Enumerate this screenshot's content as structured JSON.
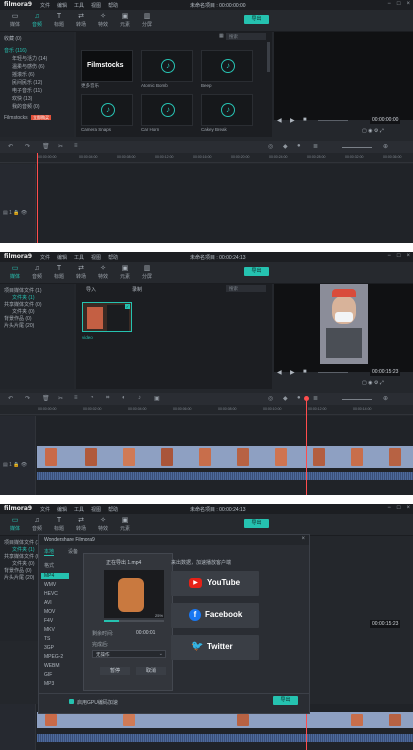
{
  "app": {
    "logo": "filmora9",
    "menu": [
      "文件",
      "编辑",
      "工具",
      "视图",
      "帮助"
    ],
    "title_1": "未命名项目 : 00:00:00:00",
    "title_2": "未命名项目 : 00:00:24:13",
    "title_3": "未命名项目 : 00:00:24:13",
    "window_controls": [
      "−",
      "□",
      "×"
    ],
    "export_label": "导出"
  },
  "toolbar": {
    "tabs": [
      {
        "label": "媒体",
        "icon": "folder-icon"
      },
      {
        "label": "音频",
        "icon": "music-icon"
      },
      {
        "label": "标题",
        "icon": "text-icon"
      },
      {
        "label": "转场",
        "icon": "transition-icon"
      },
      {
        "label": "特效",
        "icon": "effects-icon"
      },
      {
        "label": "元素",
        "icon": "elements-icon"
      },
      {
        "label": "分屏",
        "icon": "splitscreen-icon"
      }
    ],
    "tabs_short": [
      "媒体",
      "音频",
      "标题",
      "转场",
      "特效",
      "元素",
      "分屏"
    ]
  },
  "panel1": {
    "sidebar": {
      "favorites": "收藏 (0)",
      "music": "音乐 (116)",
      "items": [
        "年轻与活力 (14)",
        "温柔与感伤 (6)",
        "摇滚乐 (6)",
        "民间民乐 (12)",
        "电子音乐 (11)",
        "欢快 (13)",
        "我的音频 (0)"
      ],
      "filmstocks": "Filmstocks",
      "filmstocks_badge": "立即购买"
    },
    "search_placeholder": "搜索",
    "items": [
      {
        "label": "更多音乐",
        "kind": "filmstocks",
        "text": "Filmstocks"
      },
      {
        "label": "Atomic Bomb",
        "kind": "music"
      },
      {
        "label": "Beep",
        "kind": "music"
      },
      {
        "label": "Camera Snaps",
        "kind": "music"
      },
      {
        "label": "Car Horn",
        "kind": "music"
      },
      {
        "label": "Cakey Break",
        "kind": "music"
      }
    ],
    "timecode": "00:00:00:00",
    "ruler": [
      "00:00:00:00",
      "00:00:04:00",
      "00:00:08:00",
      "00:00:12:00",
      "00:00:16:00",
      "00:00:20:00",
      "00:00:24:00",
      "00:00:28:00",
      "00:00:32:00",
      "00:00:36:00",
      "00:00:40:00"
    ]
  },
  "panel2": {
    "sidebar": {
      "items": [
        "项目媒体文件 (1)",
        "文件夹 (1)",
        "共享媒体文件 (0)",
        "文件夹 (0)",
        "背景作品 (0)",
        "片头片尾 (20)"
      ]
    },
    "import_label": "导入",
    "record_label": "录制",
    "search_placeholder": "搜索",
    "clip_label": "video",
    "timecode": "00:00:15:23",
    "ruler": [
      "00:00:00:00",
      "00:00:02:00",
      "00:00:04:00",
      "00:00:06:00",
      "00:00:08:00",
      "00:00:10:00",
      "00:00:12:00",
      "00:00:14:00"
    ]
  },
  "panel3": {
    "dialog": {
      "title": "Wondershare Filmora9",
      "tabs": [
        "本地",
        "设备"
      ],
      "section_label": "格式",
      "formats": [
        "MP4",
        "WMV",
        "HEVC",
        "AVI",
        "MOV",
        "F4V",
        "MKV",
        "TS",
        "3GP",
        "MPEG-2",
        "WEBM",
        "GIF",
        "MP3"
      ],
      "selected_format": "MP4",
      "progress_title": "正在导出 1.mp4",
      "progress_percent": 25,
      "progress_label": "25%",
      "remaining_label": "剩余时间:",
      "remaining_value": "00:00:01",
      "finish_label": "完成后:",
      "finish_value": "无操作",
      "pause_label": "暂停",
      "cancel_label": "取消",
      "share_title": "来出数据，加速播放客户端",
      "share_buttons": [
        "YouTube",
        "Facebook",
        "Twitter"
      ],
      "gpu_label": "启用GPU编码加速",
      "export_label": "导出"
    },
    "timecode": "00:00:15:23"
  },
  "colors": {
    "accent": "#25c2b0",
    "playhead": "#ff4d4d",
    "youtube": "#e62117",
    "facebook": "#1877f2",
    "twitter": "#1da1f2"
  }
}
